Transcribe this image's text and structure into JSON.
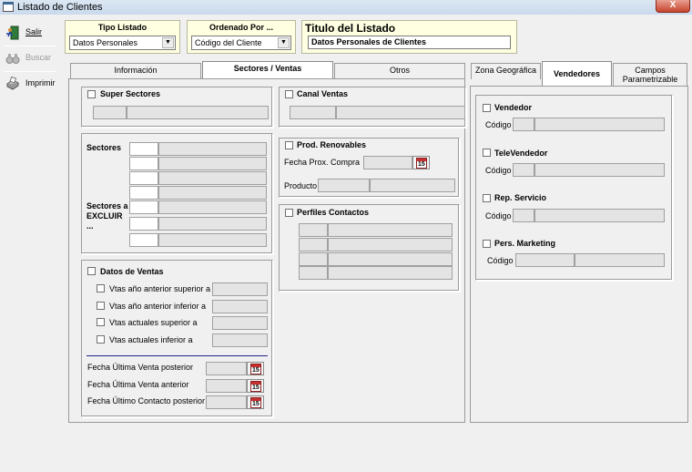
{
  "window": {
    "title": "Listado de Clientes",
    "close_glyph": "X"
  },
  "toolbar": {
    "salir": "Salir",
    "buscar": "Buscar",
    "imprimir": "Imprimir"
  },
  "tipo_listado": {
    "caption": "Tipo Listado",
    "value": "Datos Personales"
  },
  "ordenado_por": {
    "caption": "Ordenado Por ...",
    "value": "Código del Cliente"
  },
  "titulo_listado": {
    "caption": "Titulo del Listado",
    "value": "Datos Personales de Clientes"
  },
  "tabs_left": {
    "informacion": "Información",
    "sectores_ventas": "Sectores /  Ventas",
    "otros": "Otros"
  },
  "tabs_right": {
    "zona": "Zona Geográfica",
    "vendedores": "Vendedores",
    "campos": "Campos Parametrizable"
  },
  "super_sectores": {
    "label": "Super Sectores"
  },
  "canal_ventas": {
    "label": "Canal Ventas"
  },
  "sectores": {
    "label": "Sectores",
    "excluir": "Sectores a EXCLUIR ..."
  },
  "prod_renovables": {
    "label": "Prod. Renovables",
    "fecha": "Fecha Prox. Compra",
    "producto": "Producto"
  },
  "perfiles": {
    "label": "Perfiles Contactos"
  },
  "datos_ventas": {
    "label": "Datos de Ventas",
    "vtas_sup_ant": "Vtas año anterior superior a",
    "vtas_inf_ant": "Vtas año anterior inferior a",
    "vtas_sup_act": "Vtas actuales superior a",
    "vtas_inf_act": "Vtas actuales inferior a",
    "fecha_ult_post": "Fecha Última Venta posterior",
    "fecha_ult_ant": "Fecha Última Venta anterior",
    "fecha_cont_post": "Fecha Último Contacto posterior a",
    "cal_day": "15"
  },
  "vendedores": {
    "vendedor": "Vendedor",
    "televendedor": "TeleVendedor",
    "rep_servicio": "Rep. Servicio",
    "pers_marketing": "Pers. Marketing",
    "codigo": "Código"
  }
}
